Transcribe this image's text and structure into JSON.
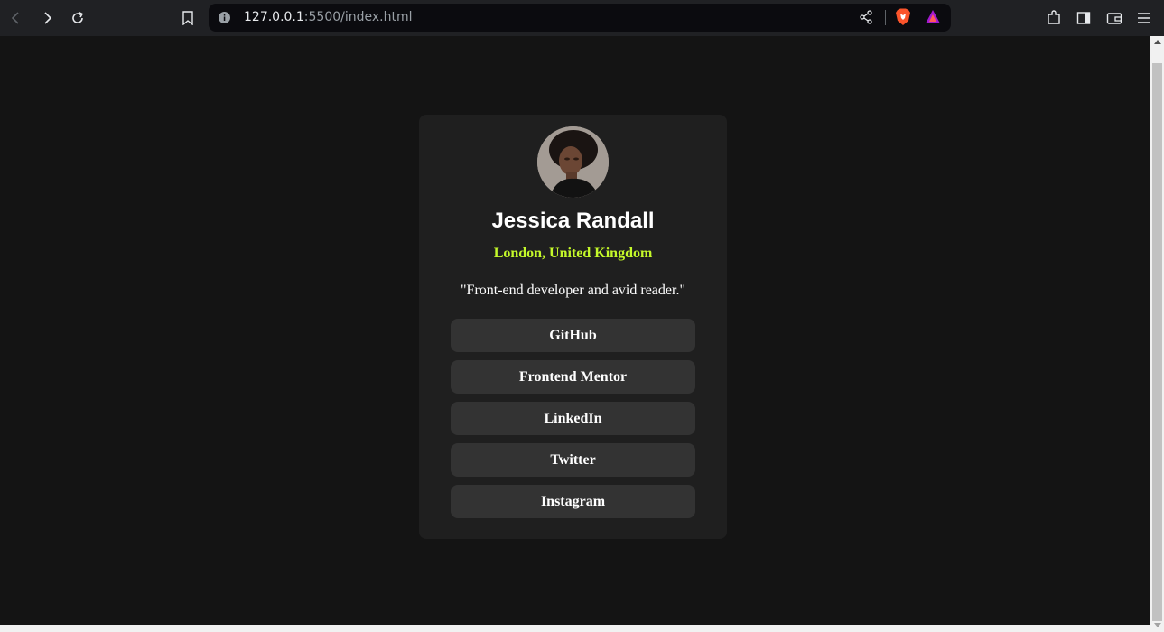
{
  "browser": {
    "url_host": "127.0.0.1",
    "url_rest": ":5500/index.html"
  },
  "profile": {
    "name": "Jessica Randall",
    "location": "London, United Kingdom",
    "bio": "\"Front-end developer and avid reader.\"",
    "links": [
      "GitHub",
      "Frontend Mentor",
      "LinkedIn",
      "Twitter",
      "Instagram"
    ]
  },
  "colors": {
    "page_bg": "#141414",
    "card_bg": "#1f1f1f",
    "button_bg": "#333333",
    "accent_green": "#c4f82a"
  }
}
